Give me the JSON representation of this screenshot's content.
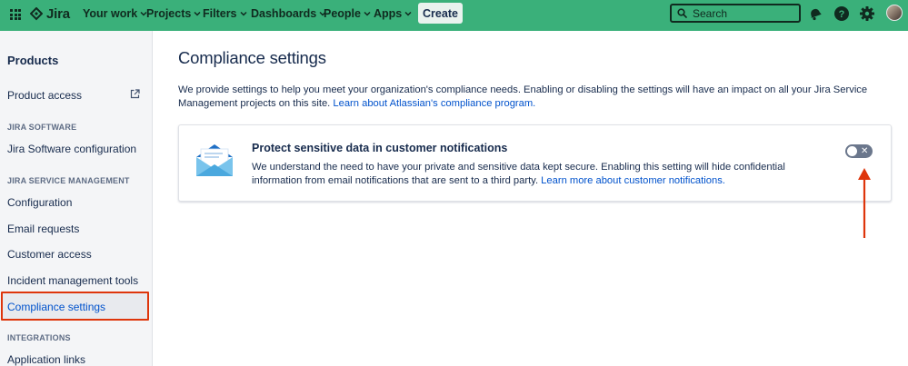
{
  "topbar": {
    "logo_text": "Jira",
    "nav": [
      "Your work",
      "Projects",
      "Filters",
      "Dashboards",
      "People",
      "Apps"
    ],
    "create_label": "Create",
    "search_placeholder": "Search"
  },
  "sidebar": {
    "heading": "Products",
    "product_access": "Product access",
    "section_jira_software": "JIRA SOFTWARE",
    "jira_software_configuration": "Jira Software configuration",
    "section_jsm": "JIRA SERVICE MANAGEMENT",
    "configuration": "Configuration",
    "email_requests": "Email requests",
    "customer_access": "Customer access",
    "incident_management_tools": "Incident management tools",
    "compliance_settings": "Compliance settings",
    "section_integrations": "INTEGRATIONS",
    "application_links": "Application links"
  },
  "main": {
    "title": "Compliance settings",
    "intro_text": "We provide settings to help you meet your organization's compliance needs. Enabling or disabling the settings will have an impact on all your Jira Service Management projects on this site. ",
    "intro_link": "Learn about Atlassian's compliance program.",
    "card": {
      "title": "Protect sensitive data in customer notifications",
      "description": "We understand the need to have your private and sensitive data kept secure. Enabling this setting will hide confidential information from email notifications that are sent to a third party. ",
      "link": "Learn more about customer notifications.",
      "toggle_enabled": false,
      "toggle_off_glyph": "✕"
    }
  },
  "colors": {
    "topbar": "#3ab07a",
    "link": "#0052cc",
    "highlight": "#de350b",
    "toggle_off": "#6b778c"
  },
  "icons": [
    "app-switcher-icon",
    "jira-logo-icon",
    "search-icon",
    "notification-icon",
    "help-icon",
    "settings-icon",
    "external-link-icon",
    "envelope-illustration-icon"
  ]
}
